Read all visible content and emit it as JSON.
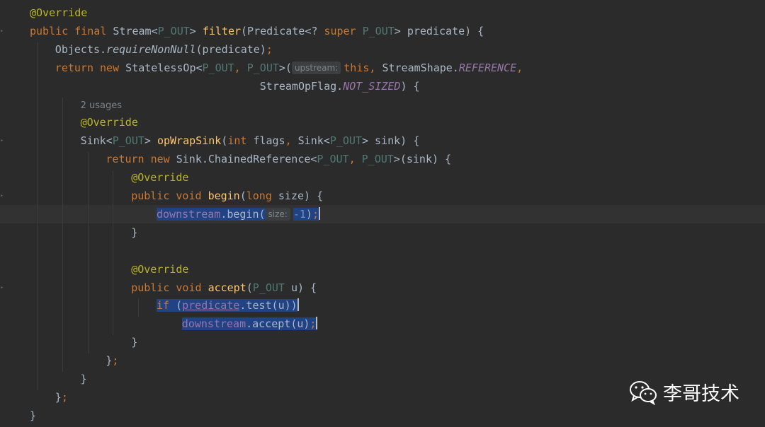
{
  "lines": [
    {
      "tokens": [
        {
          "c": "ann",
          "t": "@Override"
        }
      ]
    },
    {
      "tokens": [
        {
          "c": "kw",
          "t": "public final "
        },
        {
          "t": "Stream<"
        },
        {
          "c": "type-p",
          "t": "P_OUT"
        },
        {
          "t": "> "
        },
        {
          "c": "fn",
          "t": "filter"
        },
        {
          "t": "(Predicate<? "
        },
        {
          "c": "kw",
          "t": "super "
        },
        {
          "c": "type-p",
          "t": "P_OUT"
        },
        {
          "t": "> predicate) {"
        }
      ]
    },
    {
      "indent": 1,
      "tokens": [
        {
          "t": "Objects."
        },
        {
          "c": "ital",
          "t": "requireNonNull"
        },
        {
          "t": "(predicate)"
        },
        {
          "c": "kw",
          "t": ";"
        }
      ]
    },
    {
      "indent": 1,
      "tokens": [
        {
          "c": "kw",
          "t": "return new "
        },
        {
          "t": "StatelessOp<"
        },
        {
          "c": "type-p",
          "t": "P_OUT"
        },
        {
          "c": "kw",
          "t": ", "
        },
        {
          "c": "type-p",
          "t": "P_OUT"
        },
        {
          "t": ">("
        },
        {
          "hint": "upstream:"
        },
        {
          "c": "kw",
          "t": "this, "
        },
        {
          "t": "StreamShape."
        },
        {
          "c": "static",
          "t": "REFERENCE"
        },
        {
          "c": "kw",
          "t": ","
        }
      ]
    },
    {
      "indent": 1,
      "pad": "                                ",
      "tokens": [
        {
          "t": "StreamOpFlag."
        },
        {
          "c": "static",
          "t": "NOT_SIZED"
        },
        {
          "t": ") {"
        }
      ]
    },
    {
      "indent": 2,
      "usage": "2 usages"
    },
    {
      "indent": 2,
      "tokens": [
        {
          "c": "ann",
          "t": "@Override"
        }
      ]
    },
    {
      "indent": 2,
      "tokens": [
        {
          "t": "Sink<"
        },
        {
          "c": "type-p",
          "t": "P_OUT"
        },
        {
          "t": "> "
        },
        {
          "c": "fn",
          "t": "opWrapSink"
        },
        {
          "t": "("
        },
        {
          "c": "kw",
          "t": "int "
        },
        {
          "t": "flags"
        },
        {
          "c": "kw",
          "t": ", "
        },
        {
          "t": "Sink<"
        },
        {
          "c": "type-p",
          "t": "P_OUT"
        },
        {
          "t": "> sink) {"
        }
      ]
    },
    {
      "indent": 3,
      "tokens": [
        {
          "c": "kw",
          "t": "return new "
        },
        {
          "t": "Sink.ChainedReference<"
        },
        {
          "c": "type-p",
          "t": "P_OUT"
        },
        {
          "c": "kw",
          "t": ", "
        },
        {
          "c": "type-p",
          "t": "P_OUT"
        },
        {
          "t": ">(sink) {"
        }
      ]
    },
    {
      "indent": 4,
      "tokens": [
        {
          "c": "ann",
          "t": "@Override"
        }
      ]
    },
    {
      "indent": 4,
      "tokens": [
        {
          "c": "kw",
          "t": "public void "
        },
        {
          "c": "fn",
          "t": "begin"
        },
        {
          "t": "("
        },
        {
          "c": "kw",
          "t": "long "
        },
        {
          "t": "size) {"
        }
      ]
    },
    {
      "indent": 5,
      "current": true,
      "tokens": [
        {
          "c": "field sel",
          "t": "downstream"
        },
        {
          "c": "sel",
          "t": ".begin("
        },
        {
          "hint": "size:"
        },
        {
          "c": "num sel",
          "t": "-1"
        },
        {
          "c": "sel",
          "t": ")"
        },
        {
          "c": "kw sel",
          "t": ";"
        },
        {
          "caret": true
        }
      ]
    },
    {
      "indent": 4,
      "tokens": [
        {
          "t": "}"
        }
      ]
    },
    {
      "indent": 4,
      "tokens": []
    },
    {
      "indent": 4,
      "tokens": [
        {
          "c": "ann",
          "t": "@Override"
        }
      ]
    },
    {
      "indent": 4,
      "tokens": [
        {
          "c": "kw",
          "t": "public void "
        },
        {
          "c": "fn",
          "t": "accept"
        },
        {
          "t": "("
        },
        {
          "c": "type-p",
          "t": "P_OUT "
        },
        {
          "t": "u) {"
        }
      ]
    },
    {
      "indent": 5,
      "tokens": [
        {
          "c": "kw sel",
          "t": "if "
        },
        {
          "c": "sel",
          "t": "("
        },
        {
          "c": "field sel under",
          "t": "predicate"
        },
        {
          "c": "sel",
          "t": ".test(u))"
        },
        {
          "caret": true
        }
      ]
    },
    {
      "indent": 6,
      "tokens": [
        {
          "c": "field sel",
          "t": "downstream"
        },
        {
          "c": "sel",
          "t": ".accept(u)"
        },
        {
          "c": "kw sel",
          "t": ";"
        },
        {
          "caret": true
        }
      ]
    },
    {
      "indent": 4,
      "tokens": [
        {
          "t": "}"
        }
      ]
    },
    {
      "indent": 3,
      "tokens": [
        {
          "t": "}"
        },
        {
          "c": "kw",
          "t": ";"
        }
      ]
    },
    {
      "indent": 2,
      "tokens": [
        {
          "t": "}"
        }
      ]
    },
    {
      "indent": 1,
      "tokens": [
        {
          "t": "}"
        },
        {
          "c": "kw",
          "t": ";"
        }
      ]
    },
    {
      "tokens": [
        {
          "t": "}"
        }
      ]
    }
  ],
  "watermark": {
    "text": "李哥技术",
    "icon": "wechat-icon"
  }
}
